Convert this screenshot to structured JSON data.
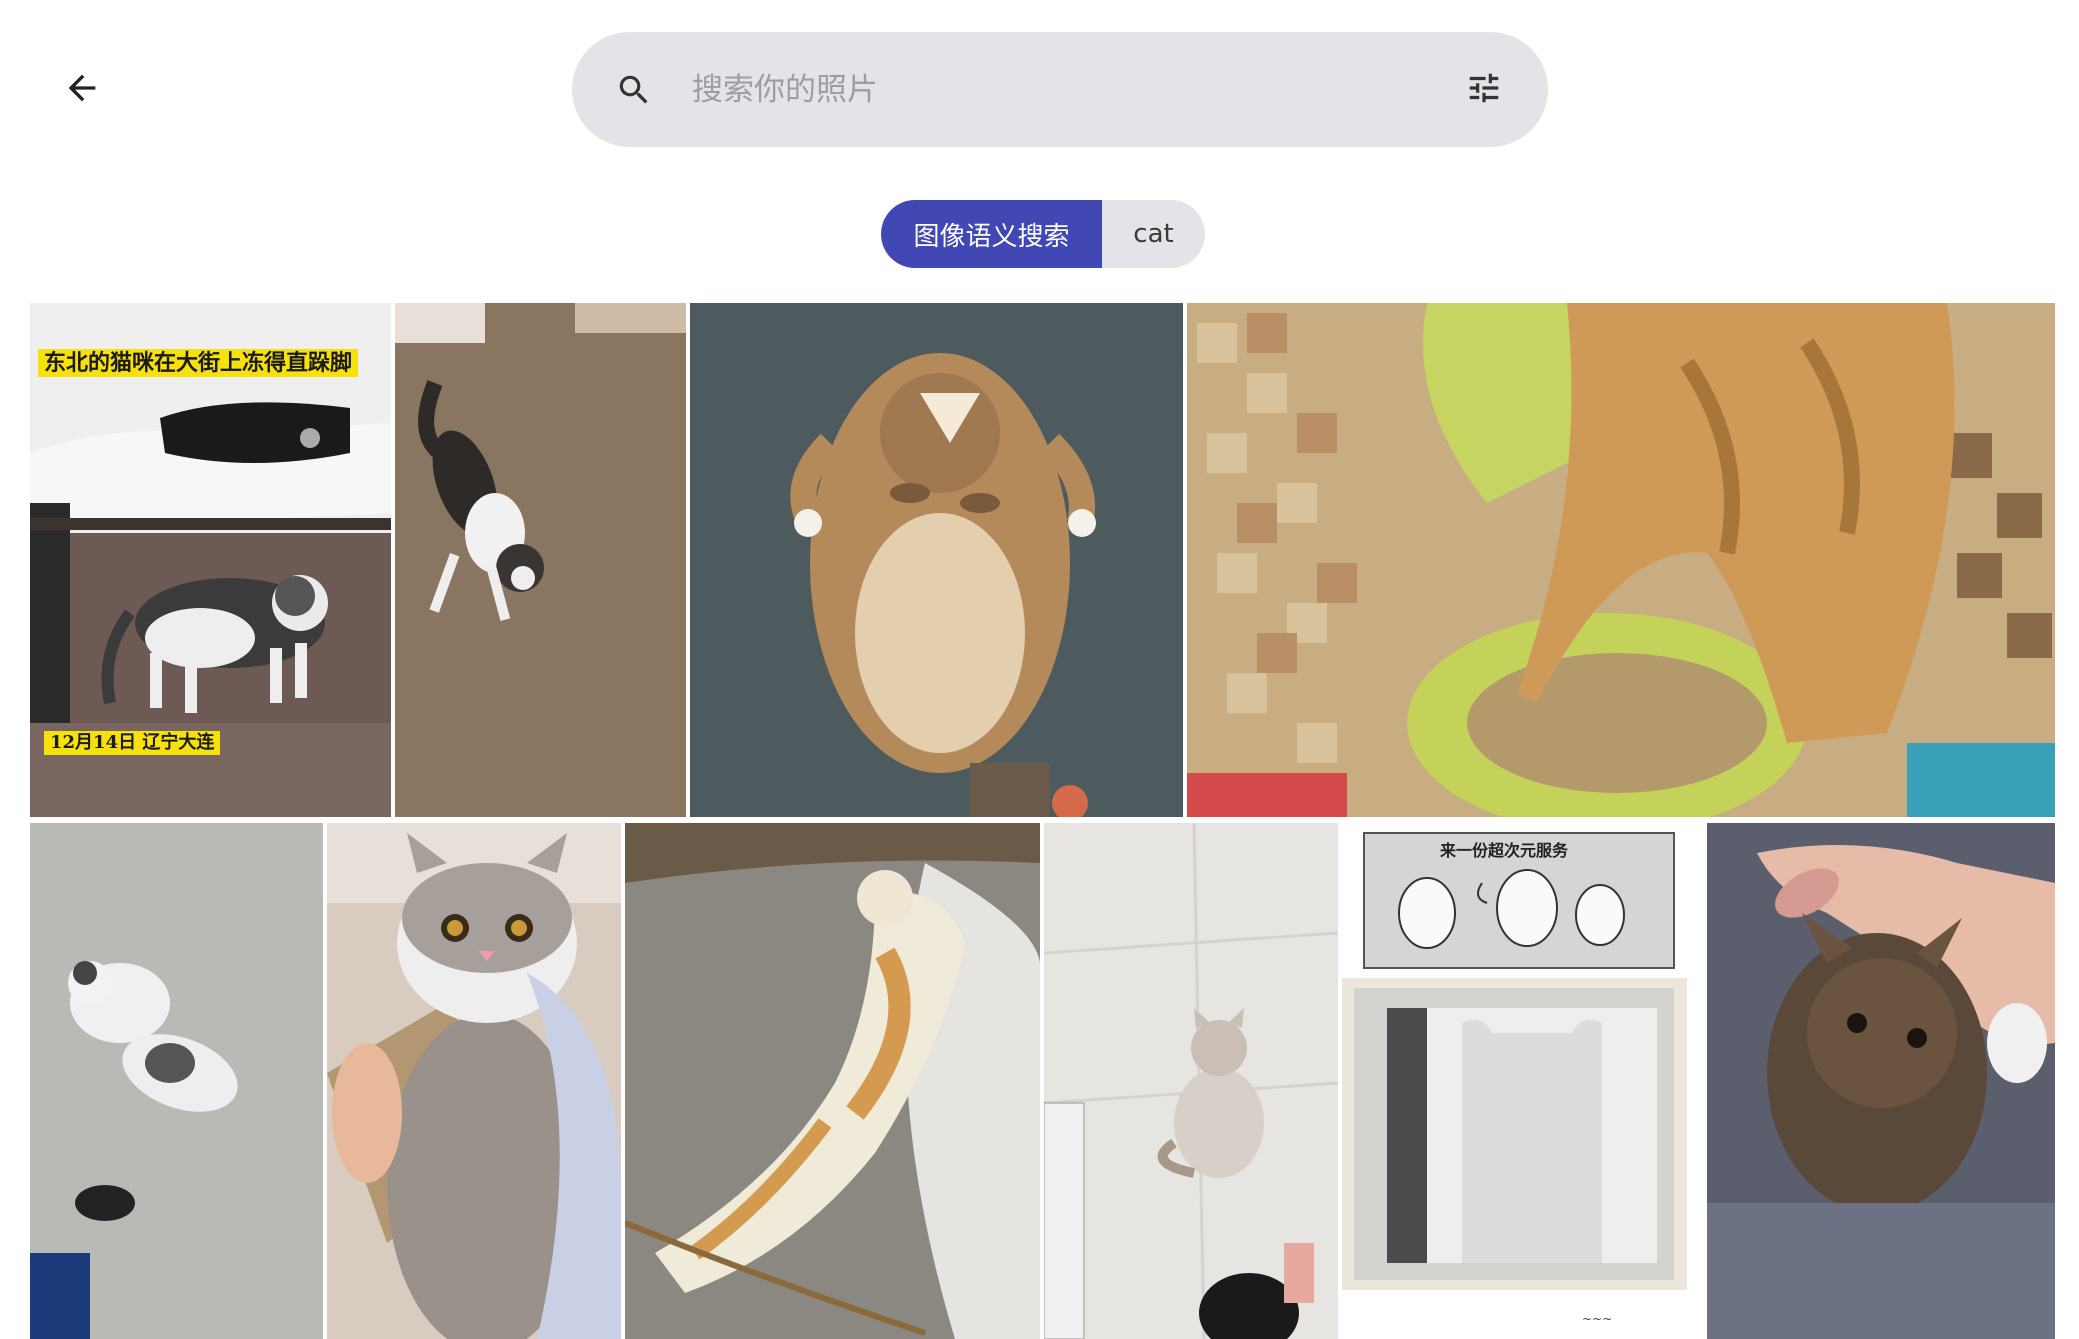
{
  "header": {
    "back_icon": "arrow-left-icon",
    "search_icon": "search-icon",
    "filter_icon": "tune-sliders-icon"
  },
  "search": {
    "placeholder": "搜索你的照片",
    "value": ""
  },
  "chips": {
    "active_label": "图像语义搜索",
    "query_label": "cat",
    "active_color": "#4147b3",
    "inactive_color": "#e3e4e8"
  },
  "photos": {
    "photo1_caption_top": "东北的猫咪在大街上冻得直跺脚",
    "photo1_caption_bottom": "12月14日 辽宁大连",
    "photo9_comic_title": "来一份超次元服务"
  },
  "colors": {
    "page_background": "#ffffff",
    "search_background": "#e3e4e8"
  }
}
